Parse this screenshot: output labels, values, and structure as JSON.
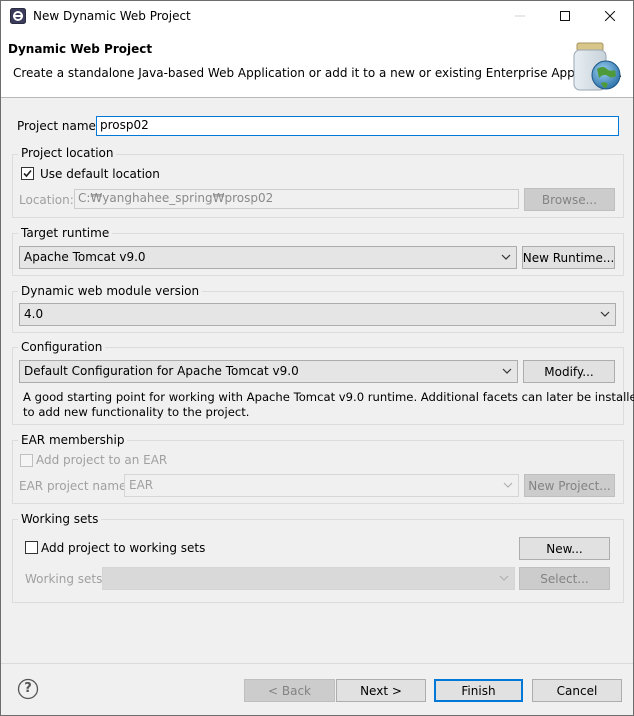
{
  "window": {
    "title": "New Dynamic Web Project"
  },
  "header": {
    "title": "Dynamic Web Project",
    "description": "Create a standalone Java-based Web Application or add it to a new or existing Enterprise Application."
  },
  "project": {
    "name_label": "Project name:",
    "name_value": "prosp02"
  },
  "location": {
    "group_label": "Project location",
    "use_default_label": "Use default location",
    "use_default_checked": true,
    "location_label": "Location:",
    "location_value": "C:₩yanghahee_spring₩prosp02",
    "browse_label": "Browse..."
  },
  "runtime": {
    "group_label": "Target runtime",
    "selected": "Apache Tomcat v9.0",
    "new_runtime_label": "New Runtime..."
  },
  "module_version": {
    "group_label": "Dynamic web module version",
    "selected": "4.0"
  },
  "configuration": {
    "group_label": "Configuration",
    "selected": "Default Configuration for Apache Tomcat v9.0",
    "modify_label": "Modify...",
    "description_line1": "A good starting point for working with Apache Tomcat v9.0 runtime. Additional facets can later be installed",
    "description_line2": "to add new functionality to the project."
  },
  "ear": {
    "group_label": "EAR membership",
    "add_label": "Add project to an EAR",
    "add_checked": false,
    "project_name_label": "EAR project name:",
    "project_name_value": "EAR",
    "new_project_label": "New Project..."
  },
  "working_sets": {
    "group_label": "Working sets",
    "add_label": "Add project to working sets",
    "add_checked": false,
    "new_label": "New...",
    "sets_label": "Working sets:",
    "sets_value": "",
    "select_label": "Select..."
  },
  "footer": {
    "help_icon": "?",
    "back_label": "< Back",
    "next_label": "Next >",
    "finish_label": "Finish",
    "cancel_label": "Cancel"
  },
  "controls": {
    "minimize": "—",
    "maximize": "☐",
    "close": "✕"
  },
  "colors": {
    "accent": "#0078d7",
    "dialog_bg": "#f0f0f0",
    "button_bg": "#e1e1e1"
  }
}
